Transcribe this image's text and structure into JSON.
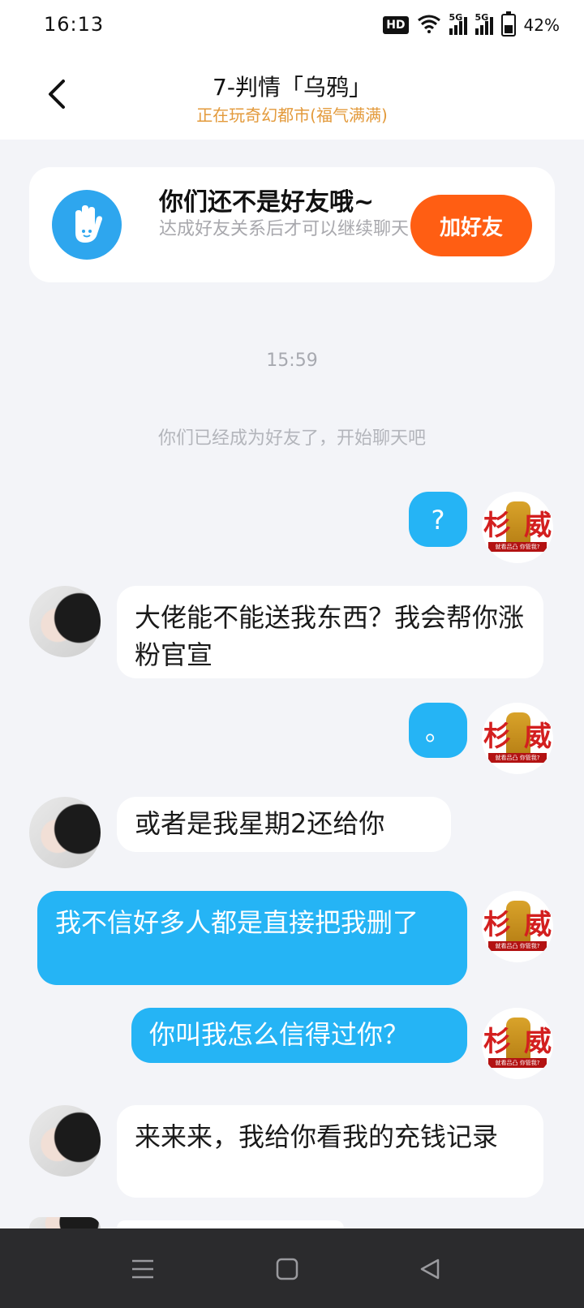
{
  "status_bar": {
    "time": "16:13",
    "hd_label": "HD",
    "signal1_label": "5G",
    "signal2_label": "5G",
    "battery": "42%"
  },
  "header": {
    "title": "7-判情「乌鸦」",
    "subtitle": "正在玩奇幻都市(福气满满)"
  },
  "notice": {
    "title": "你们还不是好友哦~",
    "text": "达成好友关系后才可以继续聊天",
    "button_label": "加好友"
  },
  "chat": {
    "timestamp": "15:59",
    "system_message": "你们已经成为好友了，开始聊天吧",
    "messages": [
      {
        "from": "self",
        "text": "?"
      },
      {
        "from": "peer",
        "text": "大佬能不能送我东西？我会帮你涨粉官宣"
      },
      {
        "from": "self",
        "text": "。"
      },
      {
        "from": "peer",
        "text": "或者是我星期2还给你"
      },
      {
        "from": "self",
        "text": "我不信好多人都是直接把我删了"
      },
      {
        "from": "self",
        "text": "你叫我怎么信得过你？"
      },
      {
        "from": "peer",
        "text": "来来来，我给你看我的充钱记录"
      }
    ],
    "self_avatar": {
      "left_glyph": "杉",
      "right_glyph": "威",
      "banner": "就看吕凸 你管我?"
    }
  },
  "colors": {
    "accent_orange": "#ff5e13",
    "bubble_out": "#25b4f5",
    "subtitle": "#e39a3b"
  }
}
